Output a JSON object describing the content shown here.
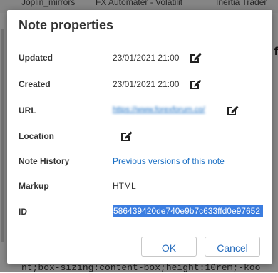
{
  "background": {
    "tabs": [
      "Joplin_mirrors",
      "FX Automater - Volatilit",
      "Inertia Trader"
    ],
    "right_char": "f",
    "code_line": "nt;box-sizing:content-box;height:10rem;-koo"
  },
  "dialog": {
    "title": "Note properties",
    "rows": {
      "updated": {
        "label": "Updated",
        "value": "23/01/2021 21:00"
      },
      "created": {
        "label": "Created",
        "value": "23/01/2021 21:00"
      },
      "url": {
        "label": "URL",
        "value": "https://www.forexforum.co/"
      },
      "location": {
        "label": "Location"
      },
      "history": {
        "label": "Note History",
        "value": "Previous versions of this note"
      },
      "markup": {
        "label": "Markup",
        "value": "HTML"
      },
      "id": {
        "label": "ID",
        "value": "586439420de740e9b7c633ffd0e97652"
      }
    },
    "buttons": {
      "ok": "OK",
      "cancel": "Cancel"
    }
  },
  "colors": {
    "link": "#1a6fc4",
    "selection": "#3b7de0",
    "button_text": "#2a6fbe"
  },
  "icons": {
    "edit": "edit-pencil-icon"
  }
}
